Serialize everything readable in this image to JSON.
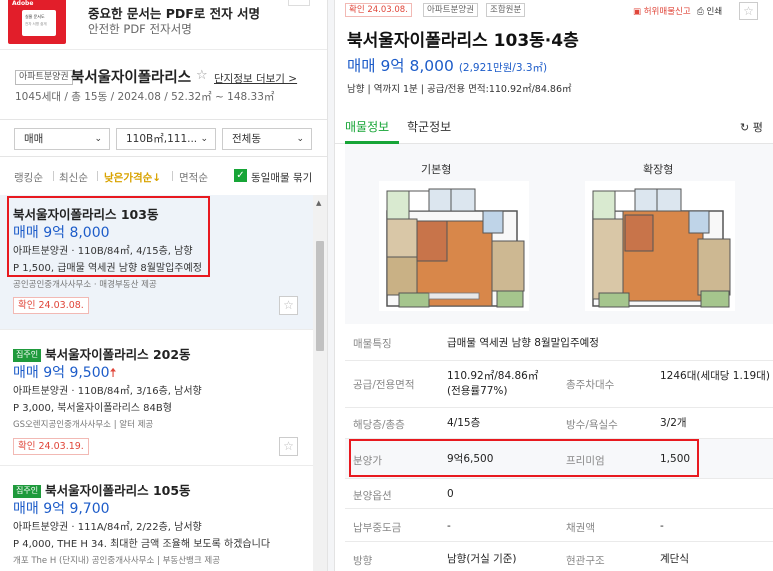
{
  "ad": {
    "logo": "Adobe",
    "thumb_line1": "실물 문서도",
    "thumb_line2": "전자 서명 쉽게",
    "title": "중요한 문서는 PDF로 전자 서명",
    "subtitle": "안전한 PDF 전자서명"
  },
  "complex": {
    "type_tag": "아파트분양권",
    "name": "북서울자이폴라리스",
    "info_link": "단지정보 더보기 >",
    "meta": "1045세대 / 총 15동 / 2024.08 / 52.32㎡ ~ 148.33㎡"
  },
  "filters": {
    "trade": "매매",
    "area": "110B㎡,111...",
    "dong": "전체동"
  },
  "sort": {
    "ranking": "랭킹순",
    "latest": "최신순",
    "low_price": "낮은가격순↓",
    "area": "면적순",
    "same_listing": "동일매물 묶기"
  },
  "listings": [
    {
      "title": "북서울자이폴라리스 103동",
      "price": "매매 9억 8,000",
      "detail": "아파트분양권 · 110B/84㎡, 4/15층, 남향",
      "desc": "P 1,500, 급매물 역세권 남향 8월말입주예정",
      "agent": "공인공인중개사사무소 · 매경부동산 제공",
      "date": "확인 24.03.08."
    },
    {
      "badge": "집주인",
      "title": "북서울자이폴라리스 202동",
      "price": "매매 9억 9,500",
      "detail": "아파트분양권 · 110B/84㎡, 3/16층, 남서향",
      "desc": "P 3,000, 북서울자이폴라리스 84B형",
      "agent": "GS오렌지공인중개사사무소 | 알터 제공",
      "date": "확인 24.03.19."
    },
    {
      "badge": "집주인",
      "title": "북서울자이폴라리스 105동",
      "price": "매매 9억 9,700",
      "detail": "아파트분양권 · 111A/84㎡, 2/22층, 남서향",
      "desc": "P 4,000, THE H 34. 최대한 금액 조율해 보도록 하겠습니다",
      "agent": "개포 The H (단지내) 공인중개사사무소 | 부동산뱅크 제공"
    }
  ],
  "detail": {
    "tag_date": "확인 24.03.08.",
    "tag_type": "아파트분양권",
    "tag_cert": "조합원분",
    "report": "허위매물신고",
    "print": "인쇄",
    "title": "북서울자이폴라리스 103동·4층",
    "price": "매매 9억 8,000",
    "price_per": "(2,921만원/3.3㎡)",
    "meta": "남향 | 역까지 1분 | 공급/전용 면적:110.92㎡/84.86㎡",
    "tabs": [
      "매물정보",
      "학군정보"
    ],
    "refresh": "평",
    "plan_basic": "기본형",
    "plan_extended": "확장형",
    "specs": [
      {
        "label": "매물특징",
        "value": "급매물 역세권 남향 8월말입주예정"
      },
      {
        "label": "공급/전용면적",
        "value": "110.92㎡/84.86㎡(전용률77%)",
        "label2": "총주차대수",
        "value2": "1246대(세대당 1.19대)"
      },
      {
        "label": "해당층/총층",
        "value": "4/15층",
        "label2": "방수/욕실수",
        "value2": "3/2개"
      },
      {
        "label": "분양가",
        "value": "9억6,500",
        "label2": "프리미엄",
        "value2": "1,500"
      },
      {
        "label": "분양옵션",
        "value": "0"
      },
      {
        "label": "납부중도금",
        "value": "-",
        "label2": "채권액",
        "value2": "-"
      },
      {
        "label": "방향",
        "value": "남향(거실 기준)",
        "label2": "현관구조",
        "value2": "계단식"
      }
    ]
  }
}
